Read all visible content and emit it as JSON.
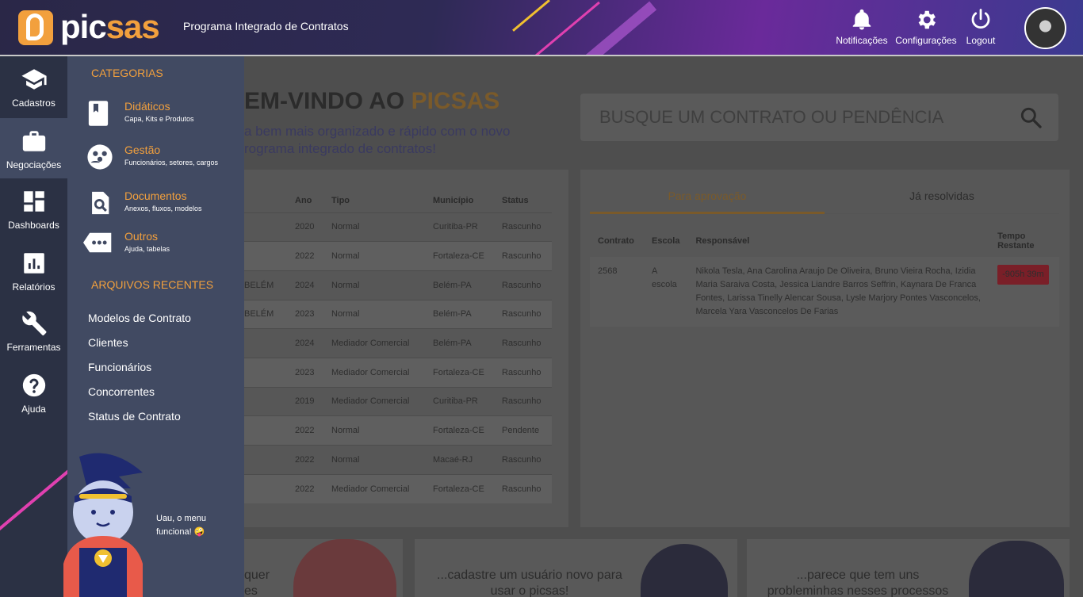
{
  "header": {
    "logo_text_a": "pic",
    "logo_text_b": "sas",
    "subtitle": "Programa Integrado de Contratos",
    "notifications_label": "Notificações",
    "settings_label": "Configurações",
    "logout_label": "Logout"
  },
  "rail": {
    "items": [
      {
        "label": "Cadastros",
        "icon": "graduation-cap-icon"
      },
      {
        "label": "Negociações",
        "icon": "briefcase-icon"
      },
      {
        "label": "Dashboards",
        "icon": "dashboard-icon"
      },
      {
        "label": "Relatórios",
        "icon": "bar-chart-icon"
      },
      {
        "label": "Ferramentas",
        "icon": "wrench-icon"
      },
      {
        "label": "Ajuda",
        "icon": "help-icon"
      }
    ]
  },
  "menu": {
    "categories_title": "CATEGORIAS",
    "categories": [
      {
        "title": "Didáticos",
        "desc": "Capa, Kits e Produtos",
        "icon": "book-icon"
      },
      {
        "title": "Gestão",
        "desc": "Funcionários, setores, cargos",
        "icon": "people-icon"
      },
      {
        "title": "Documentos",
        "desc": "Anexos, fluxos, modelos",
        "icon": "document-search-icon"
      },
      {
        "title": "Outros",
        "desc": "Ajuda, tabelas",
        "icon": "more-tag-icon"
      }
    ],
    "recent_title": "ARQUIVOS RECENTES",
    "recent": [
      "Modelos de Contrato",
      "Clientes",
      "Funcionários",
      "Concorrentes",
      "Status de Contrato"
    ],
    "mascot_line1": "Uau, o menu",
    "mascot_line2": "funciona! 🤪"
  },
  "welcome": {
    "title_a": "EM-VINDO AO ",
    "title_b": "PICSAS",
    "sub_line1": "a bem mais organizado e rápido com o novo",
    "sub_line2": "rograma integrado de contratos!"
  },
  "search": {
    "placeholder": "BUSQUE UM CONTRATO OU PENDÊNCIA"
  },
  "contracts_table": {
    "headers": [
      "",
      "Ano",
      "Tipo",
      "Município",
      "Status"
    ],
    "rows": [
      [
        "",
        "2020",
        "Normal",
        "Curitiba-PR",
        "Rascunho"
      ],
      [
        "",
        "2022",
        "Normal",
        "Fortaleza-CE",
        "Rascunho"
      ],
      [
        "BELÉM",
        "2024",
        "Normal",
        "Belém-PA",
        "Rascunho"
      ],
      [
        "BELÉM",
        "2023",
        "Normal",
        "Belém-PA",
        "Rascunho"
      ],
      [
        "",
        "2024",
        "Mediador Comercial",
        "Belém-PA",
        "Rascunho"
      ],
      [
        "",
        "2023",
        "Mediador Comercial",
        "Fortaleza-CE",
        "Rascunho"
      ],
      [
        "",
        "2019",
        "Mediador Comercial",
        "Curitiba-PR",
        "Rascunho"
      ],
      [
        "",
        "2022",
        "Normal",
        "Fortaleza-CE",
        "Pendente"
      ],
      [
        "",
        "2022",
        "Normal",
        "Macaé-RJ",
        "Rascunho"
      ],
      [
        "",
        "2022",
        "Mediador Comercial",
        "Fortaleza-CE",
        "Rascunho"
      ]
    ]
  },
  "approvals": {
    "tab_pending": "Para aprovação",
    "tab_resolved": "Já resolvidas",
    "headers": [
      "Contrato",
      "Escola",
      "Responsável",
      "Tempo Restante"
    ],
    "rows": [
      {
        "contrato": "2568",
        "escola": "A escola",
        "responsavel": "Nikola Tesla, Ana Carolina Araujo De Oliveira, Bruno Vieira Rocha, Izidia Maria Saraiva Costa, Jessica Liandre Barros Seffrin, Kaynara De Franca Fontes, Larissa Tinelly Alencar Sousa, Lysle Marjory Pontes Vasconcelos, Marcela Yara Vasconcelos De Farias",
        "tempo": "-905h 39m"
      }
    ]
  },
  "cards": {
    "card1_line1": "quer",
    "card1_line2": "es",
    "card2_line1": "...cadastre um usuário novo para",
    "card2_line2": "usar o picsas!",
    "card3_line1": "...parece que tem uns",
    "card3_line2": "probleminhas nesses processos"
  },
  "colors": {
    "accent": "#f2a03d",
    "rail": "#2b3144",
    "menu": "#414a62",
    "danger": "#7a1f28"
  }
}
